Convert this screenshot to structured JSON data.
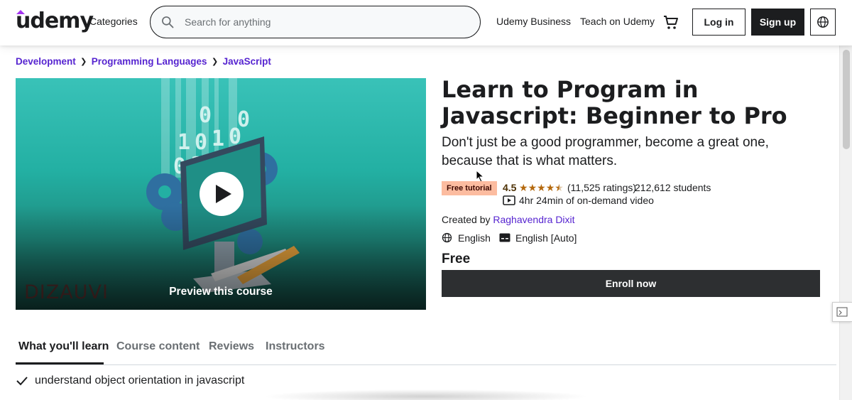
{
  "header": {
    "logo": "udemy",
    "categories": "Categories",
    "search_placeholder": "Search for anything",
    "udemy_business": "Udemy Business",
    "teach": "Teach on Udemy",
    "login": "Log in",
    "signup": "Sign up"
  },
  "breadcrumb": [
    "Development",
    "Programming Languages",
    "JavaScript"
  ],
  "preview": {
    "label": "Preview this course",
    "watermark": "DIZAUVI"
  },
  "course": {
    "title": "Learn to Program in Javascript: Beginner to Pro",
    "subtitle": "Don't just be a good programmer, become a great one, because that is what matters.",
    "badge": "Free tutorial",
    "rating": "4.5",
    "stars": 4.5,
    "ratings_count": "(11,525 ratings)",
    "students": "212,612 students",
    "video_length": "4hr 24min of on-demand video",
    "created_by_label": "Created by",
    "author": "Raghavendra Dixit",
    "language": "English",
    "captions": "English [Auto]",
    "price": "Free",
    "enroll": "Enroll now"
  },
  "tabs": [
    "What you'll learn",
    "Course content",
    "Reviews",
    "Instructors"
  ],
  "learn_items": [
    "understand object orientation in javascript"
  ],
  "colors": {
    "brand_purple": "#5624d0",
    "dark": "#1c1d1f",
    "badge_bg": "#fcbca0",
    "star": "#b4690e"
  }
}
